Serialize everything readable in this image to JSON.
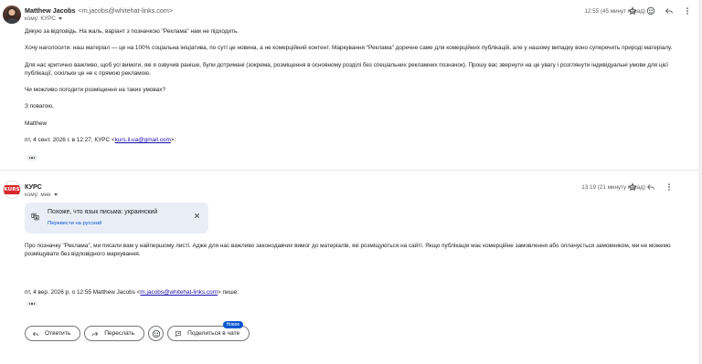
{
  "message1": {
    "sender_name": "Matthew Jacobs",
    "sender_email": "<m.jacobs@whitehat-links.com>",
    "to_line": "кому: КУРС",
    "time": "12:55 (45 минут назад)",
    "body": [
      "Дякую за відповідь. На жаль, варіант з позначкою \"Реклама\" нам не підходить.",
      "Хочу наголосити: наш матеріал — це на 100% соціальна ініціатива, по суті це новина, а не комерційний контент. Маркування \"Реклама\" доречне саме для комерційних публікацій, але у нашому випадку воно суперечить природі матеріалу.",
      "Для нас критично важливо, щоб усі вимоги, які я озвучив раніше, були дотримані (зокрема, розміщення в основному розділі без спеціальних рекламних позначок). Прошу вас звернути на це увагу і розглянути індивідуальні умови для цієї публікації, оскільки це не є прямою рекламою.",
      "Чи можливо погодити розміщення на таких умовах?",
      "З повагою,",
      "Matthew"
    ],
    "quote_prefix": "пт, 4 сент. 2026 г. в 12:27, КУРС <",
    "quote_link": "kurs.il.ua@gmail.com",
    "quote_suffix": ">:"
  },
  "message2": {
    "sender_name": "КУРС",
    "to_line": "кому: мне",
    "time": "13:19 (21 минуту назад)",
    "avatar_text": "KURS",
    "lang_notice": {
      "title": "Похоже, что язык письма: украинский",
      "link": "Перевести на русский"
    },
    "body": [
      "Про позначку \"Реклама\", ми писали вам у найпершому листі. Адже для нас важливо законодавчих вимог до матеріалів, які розміщуються на сайті. Якщо публікація має комерційне замовлення або оплачується замовником, ми не можемо розміщувати  без відповідного маркування."
    ],
    "quote_prefix": "пт, 4 вер. 2026 р. о 12:55 Matthew Jacobs <",
    "quote_link": "m.jacobs@whitehat-links.com",
    "quote_suffix": "> пише:"
  },
  "actions": {
    "reply": "Ответить",
    "forward": "Переслать",
    "share_chat": "Поделиться в чате",
    "new_badge": "Новое"
  },
  "colors": {
    "accent": "#0b57d0",
    "kurs_red": "#d9262b",
    "lang_card_bg": "#e9eef6"
  }
}
